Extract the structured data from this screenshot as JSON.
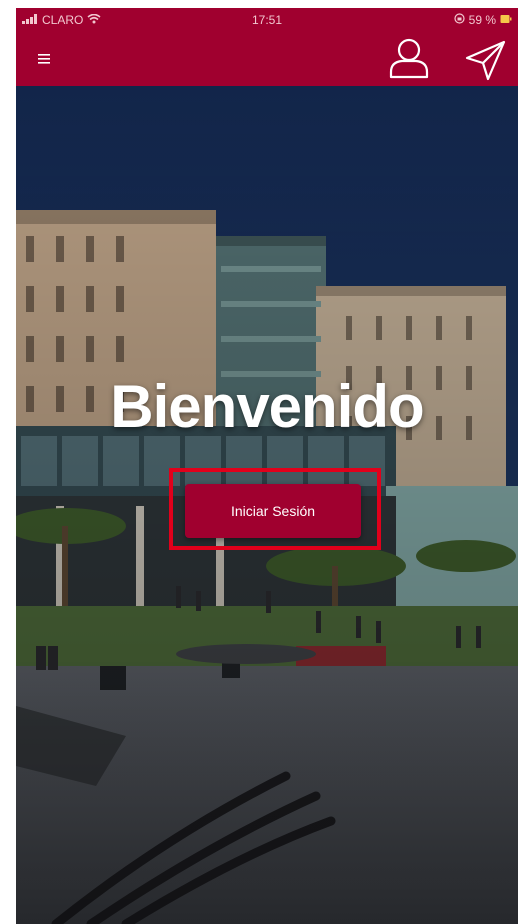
{
  "status_bar": {
    "carrier": "CLARO",
    "time": "17:51",
    "battery": "59 %"
  },
  "header": {
    "menu_icon": "hamburger-menu-icon",
    "user_icon": "user-icon",
    "send_icon": "paper-plane-icon",
    "color": "#a0002f"
  },
  "main": {
    "welcome_text": "Bienvenido",
    "login_button_label": "Iniciar Sesión",
    "highlight_color": "#e0001b"
  }
}
